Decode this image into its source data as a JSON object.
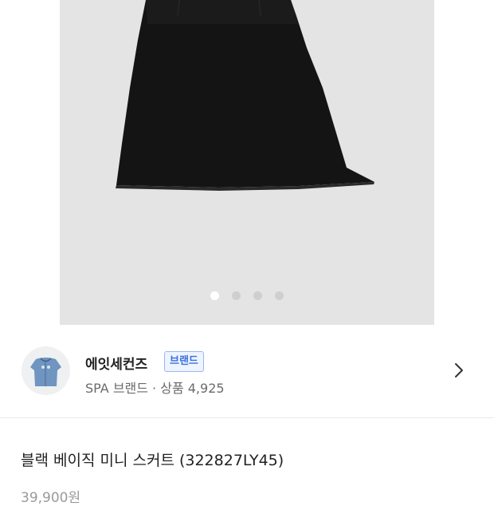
{
  "gallery": {
    "image_name": "black skirt product photo",
    "slides_total": 4,
    "active_slide": 1
  },
  "store": {
    "name": "에잇세컨즈",
    "badge": "브랜드",
    "sub": "SPA 브랜드 · 상품 4,925",
    "arrow_icon": "chevron-right-icon"
  },
  "product": {
    "title": "블랙 베이직 미니 스커트 (322827LY45)",
    "price": "39,900원"
  }
}
